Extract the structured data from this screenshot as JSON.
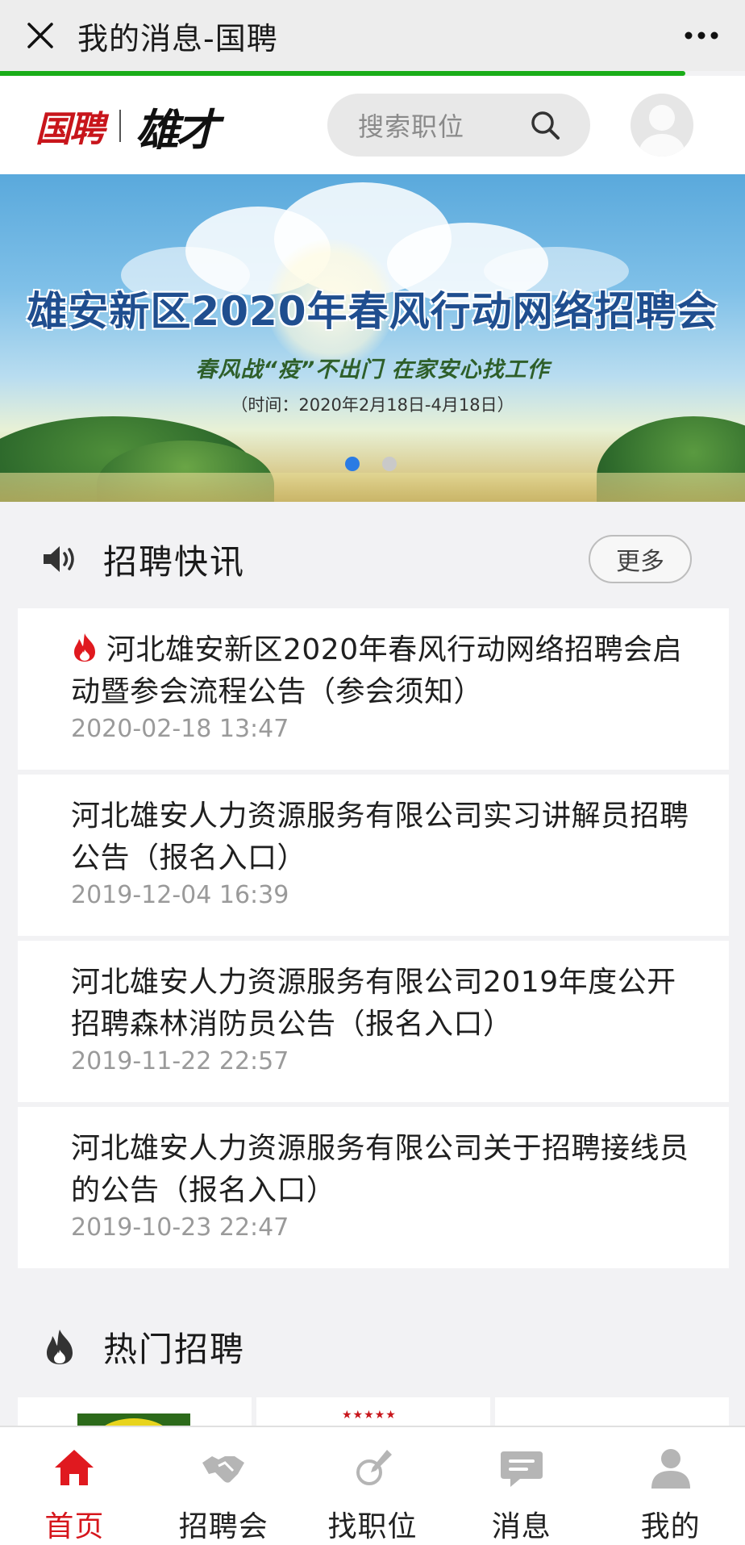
{
  "topbar": {
    "title": "我的消息-国聘",
    "close_icon": "close-icon",
    "more_icon": "more-dots-icon",
    "load_progress": 0.92
  },
  "header": {
    "logo_primary": "国聘",
    "logo_secondary": "雄才",
    "search_placeholder": "搜索职位",
    "search_icon": "search-icon",
    "avatar_icon": "user-avatar-icon"
  },
  "banner": {
    "headline": "雄安新区2020年春风行动网络招聘会",
    "subline": "春风战“疫”不出门    在家安心找工作",
    "time": "（时间：2020年2月18日-4月18日）",
    "slide_count": 2,
    "active_slide": 0
  },
  "news": {
    "section_title": "招聘快讯",
    "section_icon": "speaker-icon",
    "more_label": "更多",
    "items": [
      {
        "title": "河北雄安新区2020年春风行动网络招聘会启动暨参会流程公告（参会须知）",
        "date": "2020-02-18 13:47",
        "hot": true
      },
      {
        "title": "河北雄安人力资源服务有限公司实习讲解员招聘公告（报名入口）",
        "date": "2019-12-04 16:39",
        "hot": false
      },
      {
        "title": "河北雄安人力资源服务有限公司2019年度公开招聘森林消防员公告（报名入口）",
        "date": "2019-11-22 22:57",
        "hot": false
      },
      {
        "title": "河北雄安人力资源服务有限公司关于招聘接线员的公告（报名入口）",
        "date": "2019-10-23 22:47",
        "hot": false
      }
    ]
  },
  "hot": {
    "section_title": "热门招聘",
    "section_icon": "fire-icon"
  },
  "tabbar": {
    "items": [
      {
        "label": "首页",
        "icon": "home-icon",
        "active": true
      },
      {
        "label": "招聘会",
        "icon": "handshake-icon",
        "active": false
      },
      {
        "label": "找职位",
        "icon": "pen-search-icon",
        "active": false
      },
      {
        "label": "消息",
        "icon": "message-icon",
        "active": false
      },
      {
        "label": "我的",
        "icon": "profile-icon",
        "active": false
      }
    ]
  },
  "colors": {
    "accent_red": "#d6161c",
    "progress_green": "#1aad19",
    "active_dot": "#2a7be4"
  }
}
